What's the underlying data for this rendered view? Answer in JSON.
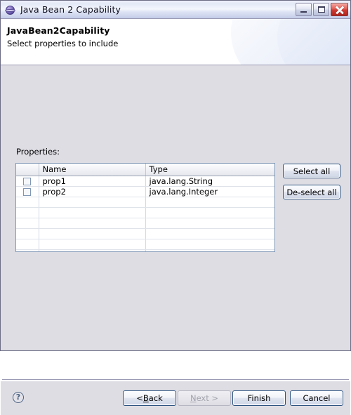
{
  "window": {
    "title": "Java Bean 2 Capability",
    "icon": "java-bean-sphere-icon",
    "controls": {
      "minimize_label": "Minimize",
      "maximize_label": "Maximize",
      "close_label": "Close"
    }
  },
  "banner": {
    "title": "JavaBean2Capability",
    "subtitle": "Select properties to include"
  },
  "content": {
    "properties_label": "Properties:",
    "table": {
      "columns": [
        "",
        "Name",
        "Type"
      ],
      "rows": [
        {
          "checked": false,
          "name": "prop1",
          "type": "java.lang.String"
        },
        {
          "checked": false,
          "name": "prop2",
          "type": "java.lang.Integer"
        }
      ],
      "empty_row_count": 6
    },
    "side_buttons": {
      "select_all": "Select all",
      "deselect_all": "De-select all"
    }
  },
  "bottom_bar": {
    "help_glyph": "?",
    "back": {
      "label": "< Back",
      "prefix": "< ",
      "mnemonic": "B",
      "suffix": "ack",
      "enabled": true
    },
    "next": {
      "label": "Next >",
      "mnemonic": "N",
      "suffix": "ext >",
      "enabled": false
    },
    "finish": {
      "label": "Finish",
      "enabled": true
    },
    "cancel": {
      "label": "Cancel",
      "enabled": true
    }
  },
  "colors": {
    "window_background": "#dedde4",
    "banner_background": "#ffffff",
    "title_bar_accent": "#c2cbe6",
    "close_button": "#cd3b33",
    "button_border": "#2c5380",
    "table_border": "#7f97b5"
  }
}
